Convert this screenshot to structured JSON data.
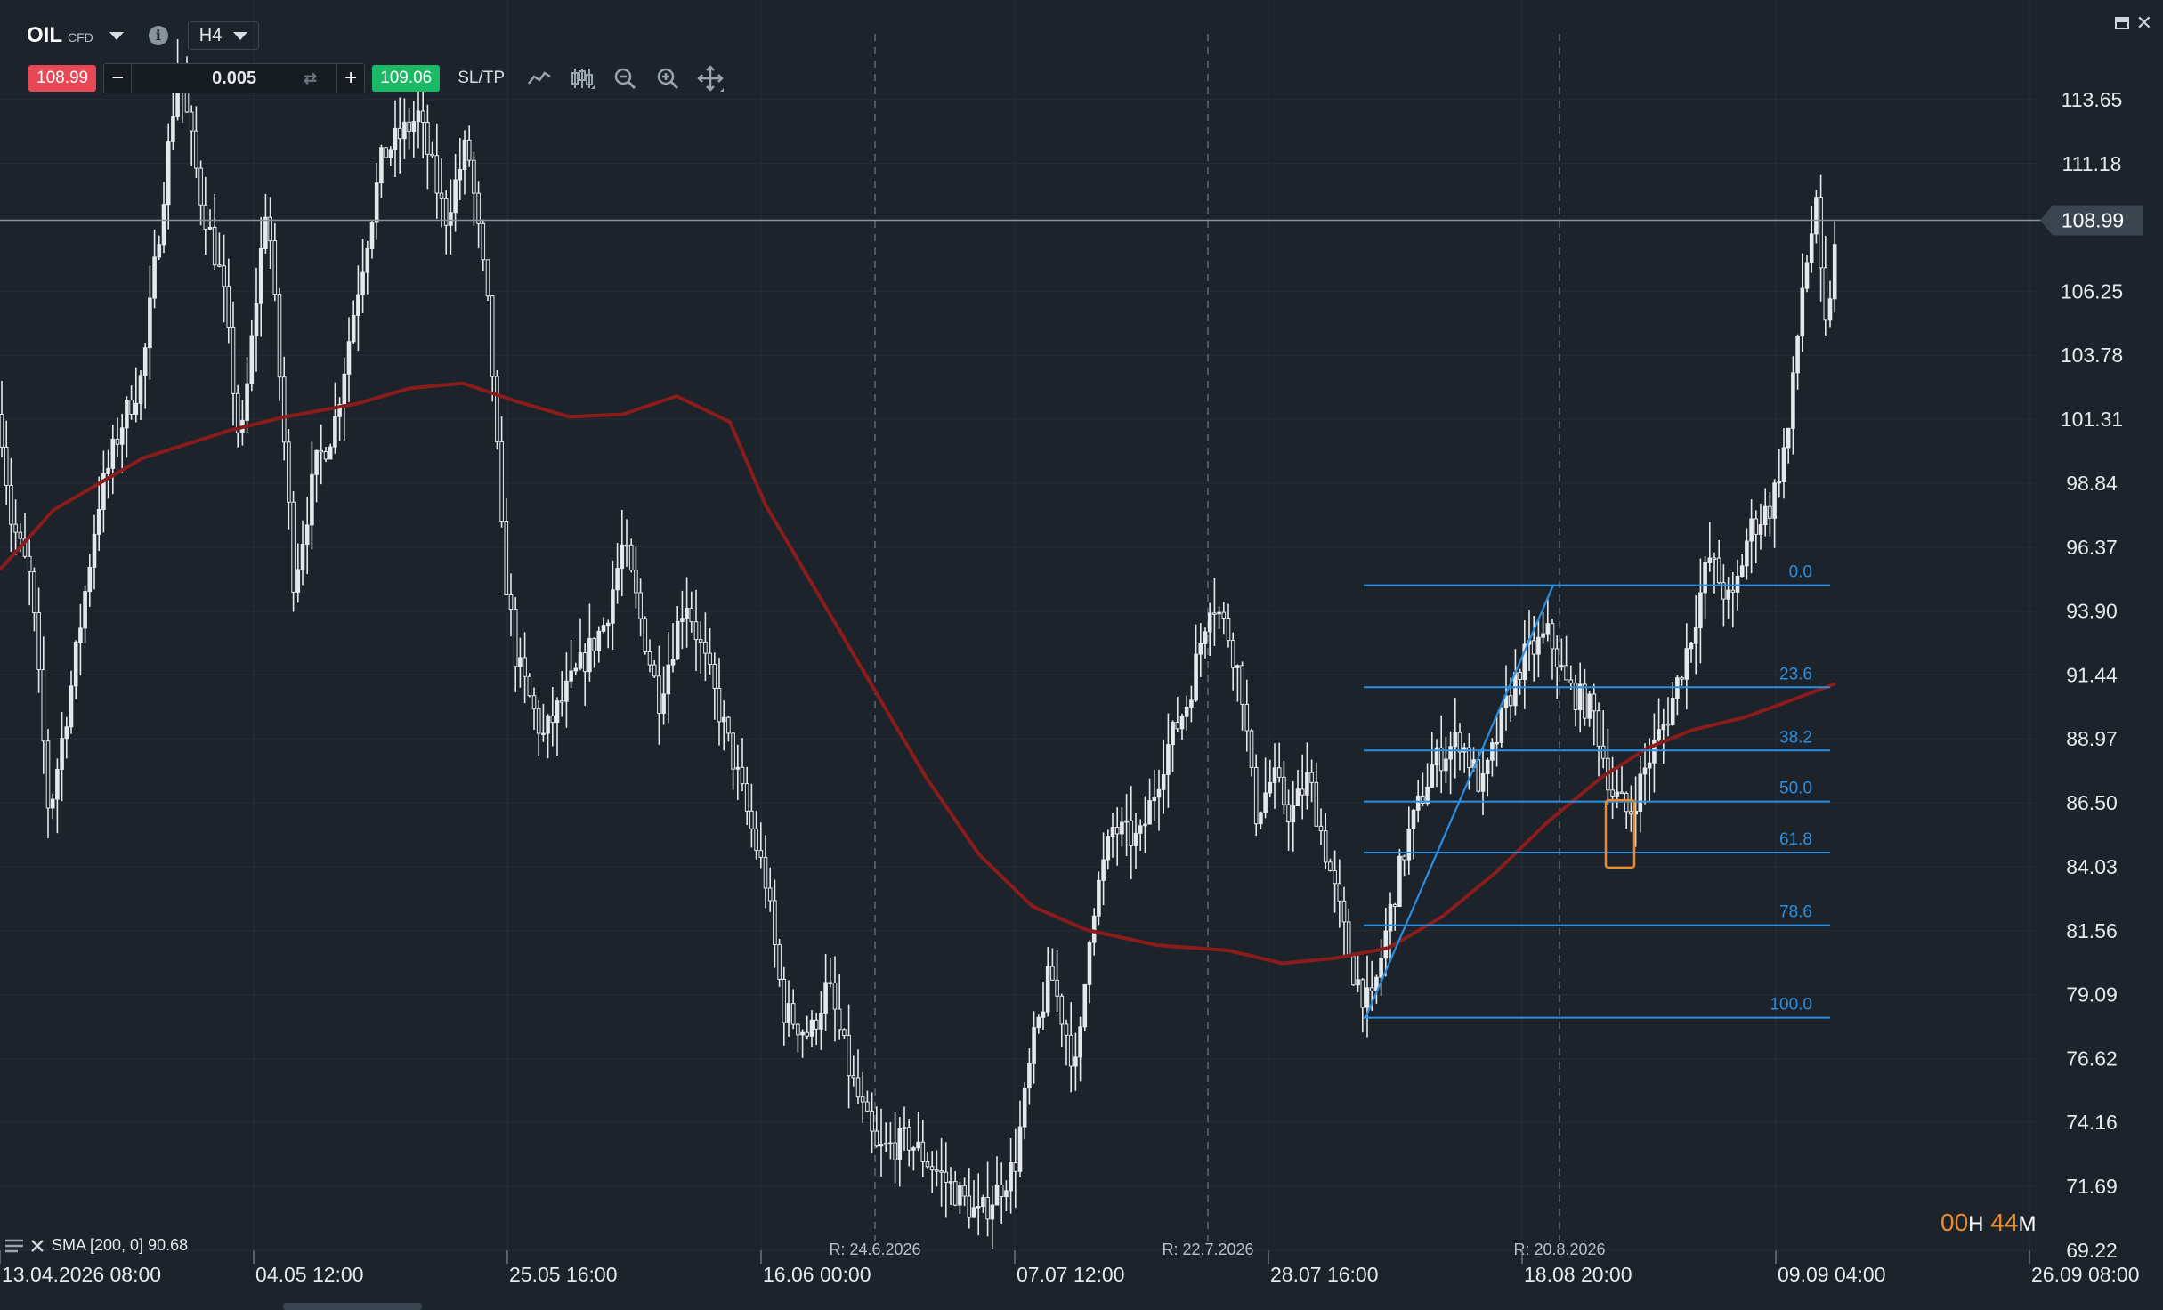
{
  "instrument": {
    "symbol": "OIL",
    "type": "CFD",
    "timeframe": "H4"
  },
  "trade_panel": {
    "sell_price": "108.99",
    "buy_price": "109.06",
    "volume": "0.005",
    "minus_label": "−",
    "plus_label": "+",
    "sltp_label": "SL/TP"
  },
  "price_axis": {
    "labels": [
      "113.65",
      "111.18",
      "108.99",
      "106.25",
      "103.78",
      "101.31",
      "98.84",
      "96.37",
      "93.90",
      "91.44",
      "88.97",
      "86.50",
      "84.03",
      "81.56",
      "79.09",
      "76.62",
      "74.16",
      "71.69",
      "69.22"
    ],
    "current_price": "108.99"
  },
  "time_axis": {
    "labels": [
      "13.04.2026 08:00",
      "04.05 12:00",
      "25.05 16:00",
      "16.06 00:00",
      "07.07 12:00",
      "28.07 16:00",
      "18.08 20:00",
      "09.09 04:00",
      "26.09 08:00"
    ]
  },
  "rollovers": [
    "R: 24.6.2026",
    "R: 22.7.2026",
    "R: 20.8.2026"
  ],
  "fibonacci": {
    "levels": [
      "0.0",
      "23.6",
      "38.2",
      "50.0",
      "61.8",
      "78.6",
      "100.0"
    ],
    "color": "#2a8fe0"
  },
  "indicator": {
    "label": "SMA [200, 0] 90.68",
    "color": "#8b1c1c"
  },
  "timer": {
    "hours": "00",
    "h_unit": "H",
    "minutes": "44",
    "m_unit": "M"
  },
  "colors": {
    "background": "#1c232b",
    "sell": "#e84855",
    "buy": "#1bb866",
    "candles": "#e6e9ec",
    "highlight": "#e88b2e"
  },
  "chart_data": {
    "type": "candlestick",
    "y_range": [
      69.22,
      116.12
    ],
    "x_labels": [
      "13.04.2026 08:00",
      "04.05 12:00",
      "25.05 16:00",
      "16.06 00:00",
      "07.07 12:00",
      "28.07 16:00",
      "18.08 20:00",
      "09.09 04:00",
      "26.09 08:00"
    ],
    "price_path": [
      [
        0,
        101.5
      ],
      [
        12,
        97.5
      ],
      [
        35,
        95.0
      ],
      [
        55,
        86.0
      ],
      [
        80,
        91.0
      ],
      [
        110,
        98.0
      ],
      [
        135,
        101.0
      ],
      [
        160,
        103.0
      ],
      [
        200,
        115.0
      ],
      [
        225,
        110.0
      ],
      [
        250,
        106.5
      ],
      [
        270,
        100.0
      ],
      [
        300,
        110.0
      ],
      [
        330,
        95.0
      ],
      [
        355,
        99.5
      ],
      [
        375,
        101.0
      ],
      [
        400,
        106.0
      ],
      [
        430,
        111.5
      ],
      [
        470,
        113.0
      ],
      [
        500,
        109.0
      ],
      [
        525,
        112.0
      ],
      [
        550,
        105.0
      ],
      [
        565,
        96.0
      ],
      [
        580,
        92.0
      ],
      [
        610,
        89.0
      ],
      [
        640,
        91.0
      ],
      [
        680,
        93.5
      ],
      [
        700,
        96.5
      ],
      [
        740,
        90.5
      ],
      [
        770,
        94.5
      ],
      [
        800,
        91.0
      ],
      [
        825,
        88.0
      ],
      [
        840,
        86.0
      ],
      [
        860,
        83.5
      ],
      [
        880,
        78.5
      ],
      [
        910,
        77.5
      ],
      [
        930,
        79.5
      ],
      [
        955,
        76.0
      ],
      [
        985,
        73.0
      ],
      [
        1020,
        73.5
      ],
      [
        1060,
        72.0
      ],
      [
        1100,
        70.5
      ],
      [
        1140,
        72.5
      ],
      [
        1160,
        77.0
      ],
      [
        1180,
        80.0
      ],
      [
        1210,
        76.0
      ],
      [
        1225,
        82.0
      ],
      [
        1250,
        85.5
      ],
      [
        1280,
        85.0
      ],
      [
        1310,
        88.5
      ],
      [
        1335,
        90.5
      ],
      [
        1360,
        94.5
      ],
      [
        1380,
        93.0
      ],
      [
        1395,
        91.0
      ],
      [
        1410,
        86.0
      ],
      [
        1430,
        87.5
      ],
      [
        1450,
        86.0
      ],
      [
        1470,
        87.5
      ],
      [
        1500,
        83.0
      ],
      [
        1520,
        80.0
      ],
      [
        1540,
        78.5
      ],
      [
        1560,
        82.0
      ],
      [
        1580,
        85.0
      ],
      [
        1610,
        88.0
      ],
      [
        1640,
        89.0
      ],
      [
        1665,
        87.0
      ],
      [
        1690,
        90.0
      ],
      [
        1710,
        92.0
      ],
      [
        1740,
        93.0
      ],
      [
        1760,
        91.0
      ],
      [
        1790,
        90.0
      ],
      [
        1810,
        87.0
      ],
      [
        1830,
        86.0
      ],
      [
        1850,
        88.0
      ],
      [
        1875,
        90.0
      ],
      [
        1900,
        93.0
      ],
      [
        1920,
        96.0
      ],
      [
        1945,
        94.0
      ],
      [
        1965,
        97.0
      ],
      [
        1990,
        98.0
      ],
      [
        2010,
        101.0
      ],
      [
        2025,
        106.5
      ],
      [
        2040,
        109.5
      ],
      [
        2050,
        104.5
      ],
      [
        2062,
        108.0
      ]
    ],
    "sma_path": [
      [
        0,
        95.5
      ],
      [
        60,
        97.8
      ],
      [
        160,
        99.8
      ],
      [
        260,
        100.9
      ],
      [
        320,
        101.4
      ],
      [
        400,
        101.9
      ],
      [
        460,
        102.5
      ],
      [
        520,
        102.7
      ],
      [
        580,
        102.0
      ],
      [
        640,
        101.4
      ],
      [
        700,
        101.5
      ],
      [
        760,
        102.2
      ],
      [
        820,
        101.2
      ],
      [
        860,
        98.0
      ],
      [
        920,
        94.5
      ],
      [
        980,
        91.0
      ],
      [
        1040,
        87.5
      ],
      [
        1100,
        84.5
      ],
      [
        1160,
        82.5
      ],
      [
        1220,
        81.6
      ],
      [
        1300,
        81.0
      ],
      [
        1380,
        80.8
      ],
      [
        1440,
        80.3
      ],
      [
        1500,
        80.5
      ],
      [
        1560,
        80.9
      ],
      [
        1620,
        82.1
      ],
      [
        1680,
        83.8
      ],
      [
        1740,
        85.8
      ],
      [
        1800,
        87.5
      ],
      [
        1850,
        88.6
      ],
      [
        1900,
        89.3
      ],
      [
        1960,
        89.8
      ],
      [
        2000,
        90.3
      ],
      [
        2062,
        91.1
      ]
    ],
    "fib_swing": {
      "low": 78.2,
      "high": 94.9,
      "x_start": 1532,
      "x_end": 2056
    },
    "current_price": 108.99
  }
}
